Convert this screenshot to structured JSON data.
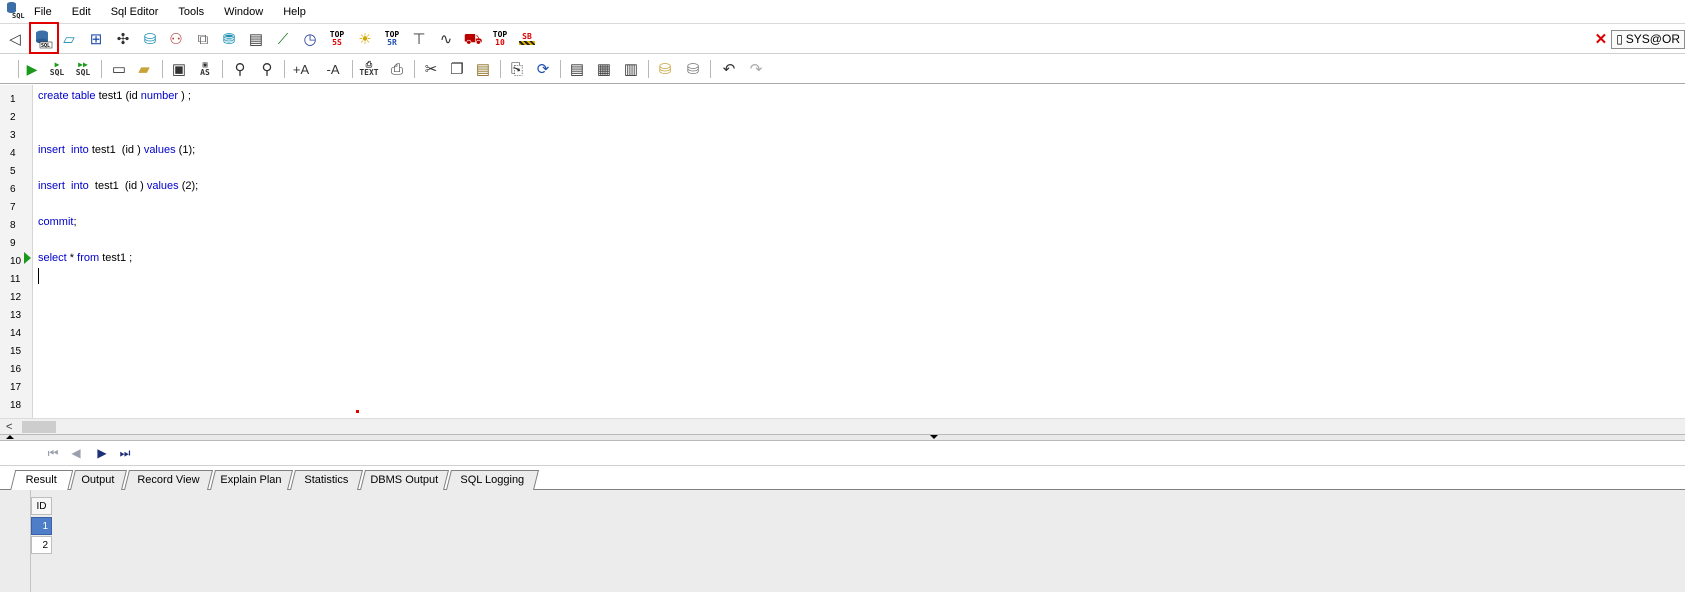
{
  "menu": {
    "items": [
      "File",
      "Edit",
      "Sql Editor",
      "Tools",
      "Window",
      "Help"
    ]
  },
  "toolbar_main": {
    "icons": [
      "back-icon",
      "sql-worksheet-icon",
      "table-icon",
      "schema-tree-icon",
      "network-icon",
      "database-icon",
      "users-icon",
      "tools-icon",
      "storage-icon",
      "stats-icon",
      "chart-icon",
      "clock-icon",
      "top-5s-icon",
      "lightbulb-icon",
      "top-5r-icon",
      "faucet-icon",
      "wave-icon",
      "car-icon",
      "top-10-icon",
      "sb-icon"
    ],
    "top5s_top": "TOP",
    "top5s_bottom": "5S",
    "top5r_top": "TOP",
    "top5r_bottom": "5R",
    "top10_top": "TOP",
    "top10_bottom": "10",
    "sb_label": "SB",
    "connection": "SYS@OR"
  },
  "toolbar_editor": {
    "sql_label": "SQL",
    "text_label": "TEXT",
    "as_label": "AS",
    "font_up": "+A",
    "font_down": "-A"
  },
  "editor": {
    "line_numbers": [
      "1",
      "2",
      "3",
      "4",
      "5",
      "6",
      "7",
      "8",
      "9",
      "10",
      "11",
      "12",
      "13",
      "14",
      "15",
      "16",
      "17",
      "18"
    ],
    "lines": {
      "l1": {
        "kw1": "create",
        "kw2": "table",
        "t1": "test1 (id ",
        "kw3": "number",
        "t2": " ) ;"
      },
      "l4": {
        "kw1": "insert",
        "kw2": "into",
        "t1": "test1  (id ) ",
        "kw3": "values",
        "t2": " (1);"
      },
      "l6": {
        "kw1": "insert",
        "kw2": "into",
        "t1": "test1  (id ) ",
        "kw3": "values",
        "t2": " (2);"
      },
      "l8": {
        "kw1": "commit",
        "t1": ";"
      },
      "l10": {
        "kw1": "select",
        "t1": " * ",
        "kw2": "from",
        "t2": " test1 ;"
      }
    },
    "current_line": "10"
  },
  "result_tabs": [
    "Result",
    "Output",
    "Record View",
    "Explain Plan",
    "Statistics",
    "DBMS Output",
    "SQL Logging"
  ],
  "active_tab": "Result",
  "grid": {
    "columns": [
      "ID"
    ],
    "rows": [
      [
        "1"
      ],
      [
        "2"
      ]
    ],
    "selected_row": 0
  },
  "colors": {
    "keyword": "#0000cc",
    "highlight_box": "#e00000",
    "run_arrow": "#1a9a1a",
    "selection": "#4f7ec9"
  }
}
